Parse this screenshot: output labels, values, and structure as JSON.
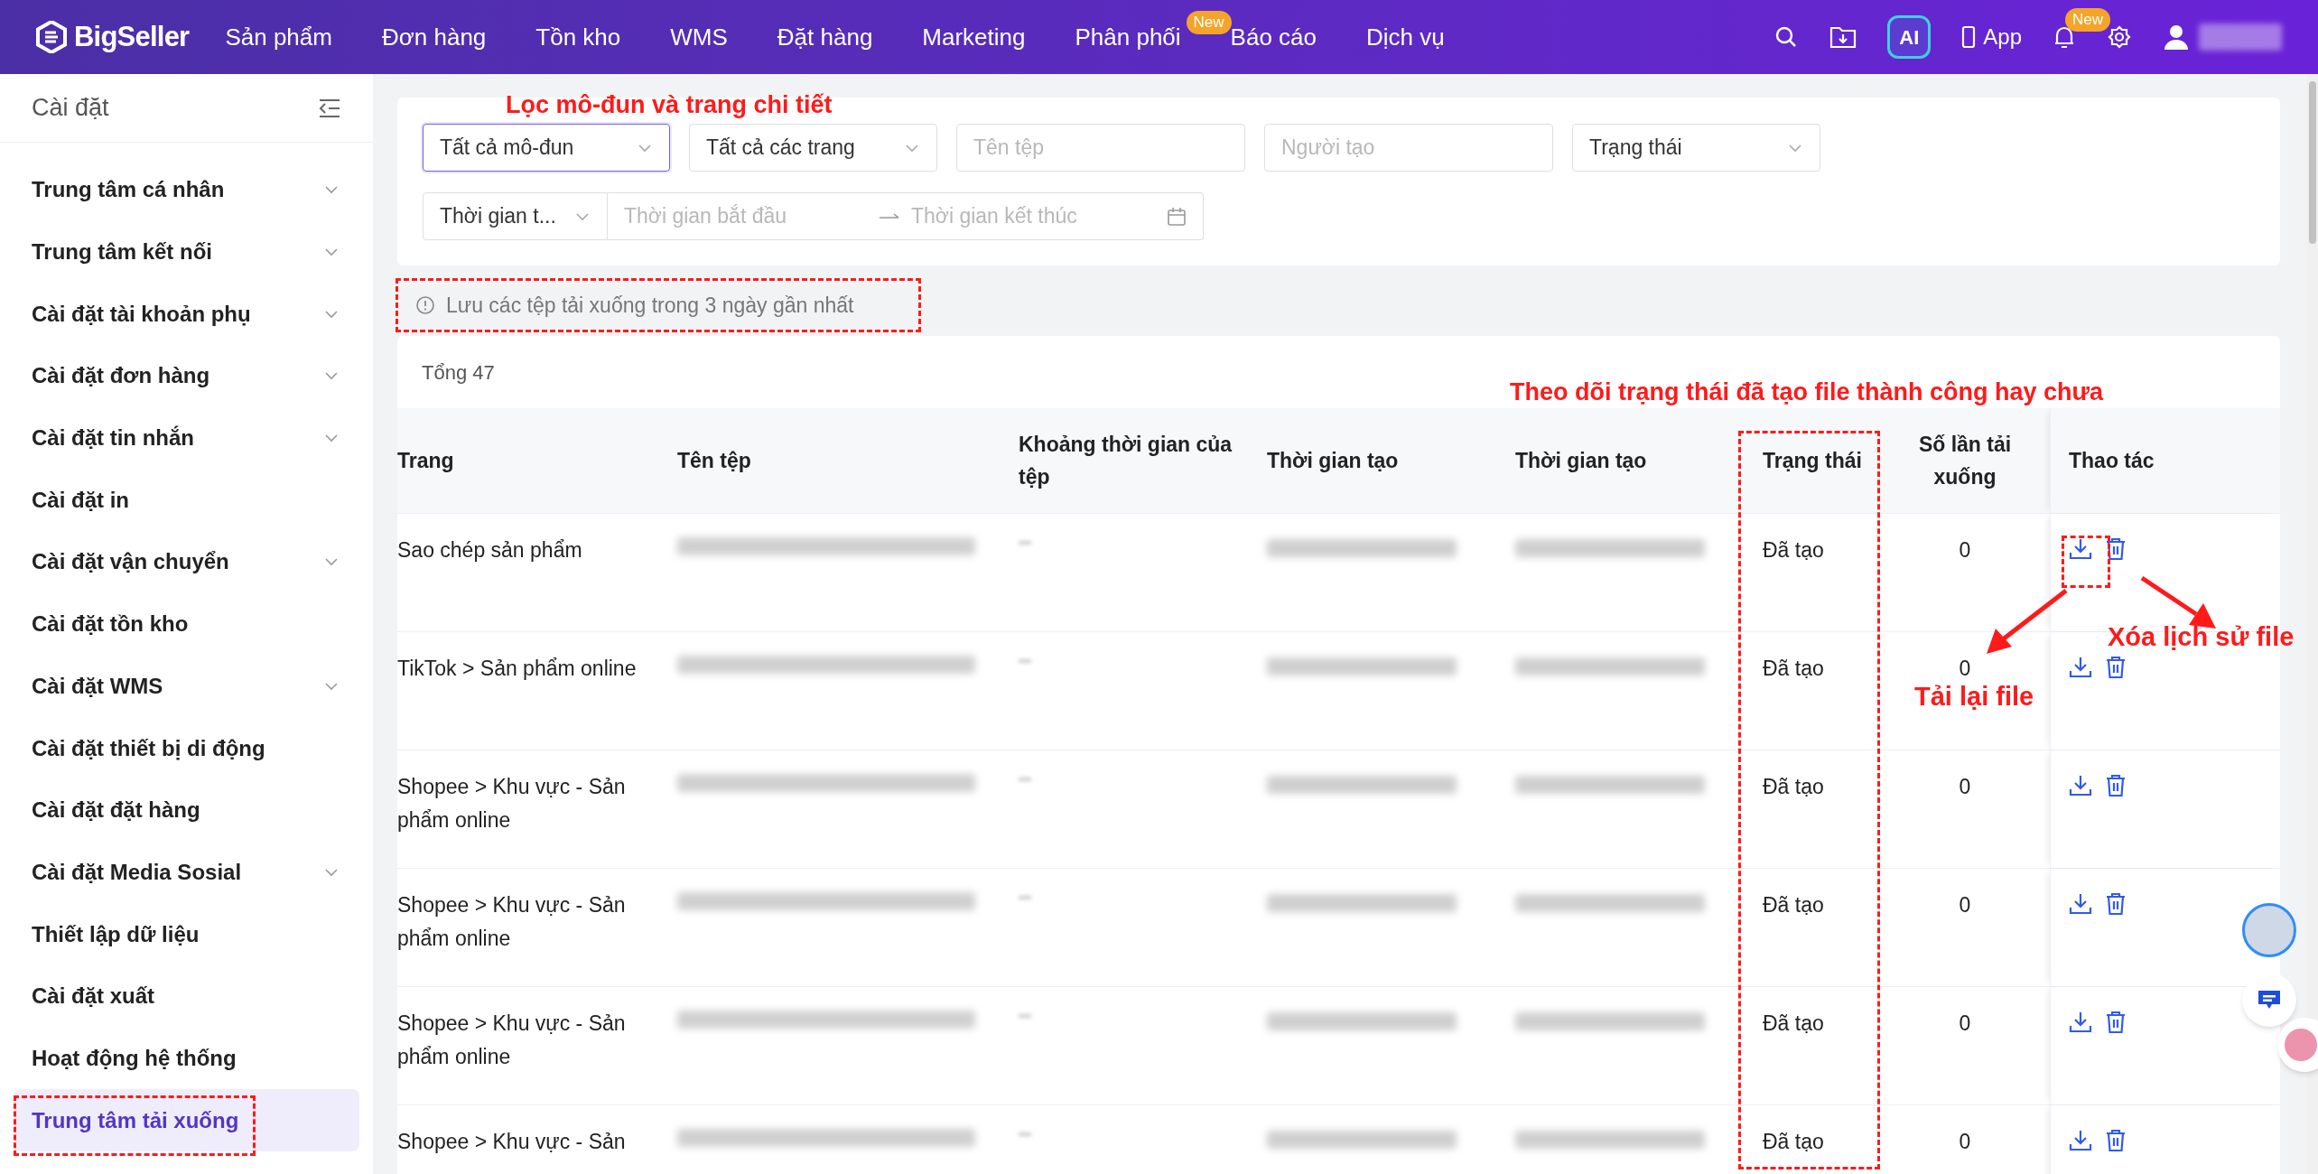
{
  "nav": {
    "logo": "BigSeller",
    "menu": [
      {
        "label": "Sản phẩm"
      },
      {
        "label": "Đơn hàng"
      },
      {
        "label": "Tồn kho"
      },
      {
        "label": "WMS"
      },
      {
        "label": "Đặt hàng"
      },
      {
        "label": "Marketing"
      },
      {
        "label": "Phân phối",
        "badge": "New"
      },
      {
        "label": "Báo cáo"
      },
      {
        "label": "Dịch vụ"
      }
    ],
    "ai": "AI",
    "app": "App",
    "bell_badge": "New"
  },
  "sidebar": {
    "title": "Cài đặt",
    "items": [
      {
        "label": "Trung tâm cá nhân",
        "expandable": true,
        "selected": false
      },
      {
        "label": "Trung tâm kết nối",
        "expandable": true,
        "selected": false
      },
      {
        "label": "Cài đặt tài khoản phụ",
        "expandable": true,
        "selected": false
      },
      {
        "label": "Cài đặt đơn hàng",
        "expandable": true,
        "selected": false
      },
      {
        "label": "Cài đặt tin nhắn",
        "expandable": true,
        "selected": false
      },
      {
        "label": "Cài đặt in",
        "expandable": false,
        "selected": false
      },
      {
        "label": "Cài đặt vận chuyển",
        "expandable": true,
        "selected": false
      },
      {
        "label": "Cài đặt tồn kho",
        "expandable": false,
        "selected": false
      },
      {
        "label": "Cài đặt WMS",
        "expandable": true,
        "selected": false
      },
      {
        "label": "Cài đặt thiết bị di động",
        "expandable": false,
        "selected": false
      },
      {
        "label": "Cài đặt đặt hàng",
        "expandable": false,
        "selected": false
      },
      {
        "label": "Cài đặt Media Sosial",
        "expandable": true,
        "selected": false
      },
      {
        "label": "Thiết lập dữ liệu",
        "expandable": false,
        "selected": false
      },
      {
        "label": "Cài đặt xuất",
        "expandable": false,
        "selected": false
      },
      {
        "label": "Hoạt động hệ thống",
        "expandable": false,
        "selected": false
      },
      {
        "label": "Trung tâm tải xuống",
        "expandable": false,
        "selected": true
      }
    ]
  },
  "filters": {
    "row_1": [
      {
        "kind": "select",
        "value": "Tất cả mô-đun",
        "focused": true
      },
      {
        "kind": "select",
        "value": "Tất cả các trang",
        "focused": false
      },
      {
        "kind": "input",
        "placeholder": "Tên tệp",
        "focused": false
      },
      {
        "kind": "input",
        "placeholder": "Người tạo",
        "focused": false
      },
      {
        "kind": "select",
        "value": "Trạng thái",
        "focused": false
      }
    ],
    "time_type": "Thời gian t...",
    "start_placeholder": "Thời gian bắt đầu",
    "end_placeholder": "Thời gian kết thúc"
  },
  "notice": "Lưu các tệp tải xuống trong 3 ngày gần nhất",
  "total": "Tổng 47",
  "table": {
    "columns": [
      "Trang",
      "Tên tệp",
      "Khoảng thời gian của tệp",
      "Thời gian tạo",
      "Thời gian tạo",
      "Trạng thái",
      "Số lần tải xuống",
      "Thao tác"
    ],
    "rows": [
      {
        "page": "Sao chép sản phẩm",
        "status": "Đã tạo",
        "downloads": "0"
      },
      {
        "page": "TikTok > Sản phẩm online",
        "status": "Đã tạo",
        "downloads": "0"
      },
      {
        "page": "Shopee > Khu vực - Sản phẩm online",
        "status": "Đã tạo",
        "downloads": "0"
      },
      {
        "page": "Shopee > Khu vực - Sản phẩm online",
        "status": "Đã tạo",
        "downloads": "0"
      },
      {
        "page": "Shopee > Khu vực - Sản phẩm online",
        "status": "Đã tạo",
        "downloads": "0"
      },
      {
        "page": "Shopee > Khu vực - Sản",
        "status": "Đã tạo",
        "downloads": "0"
      }
    ]
  },
  "annotations": {
    "filter_note": "Lọc mô-đun và trang chi tiết",
    "status_note": "Theo dõi trạng thái đã tạo file thành công hay chưa",
    "redownload_note": "Tải lại file",
    "delete_note": "Xóa lịch sử file"
  }
}
